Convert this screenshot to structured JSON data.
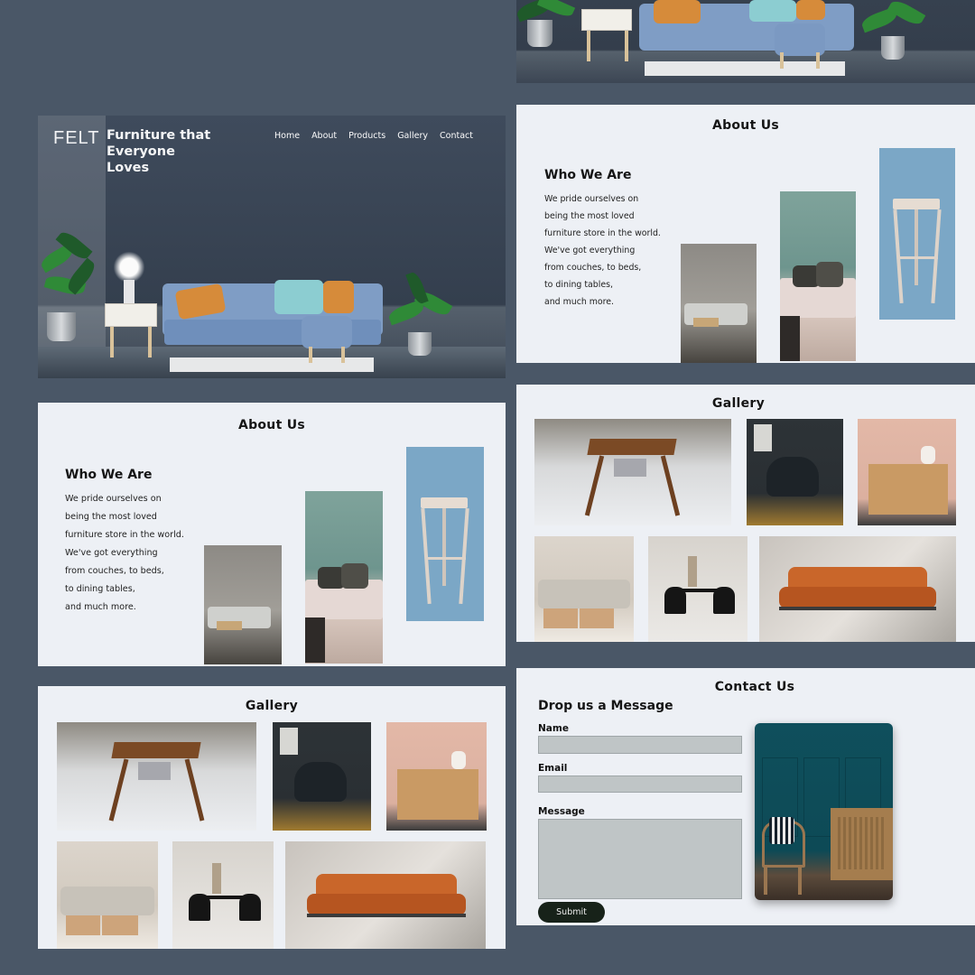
{
  "brand": {
    "logo": "FELT",
    "tagline": "Furniture that Everyone Loves"
  },
  "nav": {
    "items": [
      "Home",
      "About",
      "Products",
      "Gallery",
      "Contact"
    ]
  },
  "about": {
    "title": "About Us",
    "heading": "Who We Are",
    "lines": [
      "We pride ourselves on",
      "being the most loved",
      "furniture store in the world.",
      "We've got everything",
      "from couches, to beds,",
      "to dining tables,",
      "and much more."
    ]
  },
  "gallery": {
    "title": "Gallery"
  },
  "contact": {
    "title": "Contact Us",
    "heading": "Drop us a Message",
    "name_label": "Name",
    "email_label": "Email",
    "message_label": "Message",
    "submit_label": "Submit"
  },
  "colors": {
    "background": "#4a5767",
    "panel": "#edf0f5",
    "field": "#bfc5c6",
    "button": "#172219",
    "accent_blue": "#7f9dc5"
  }
}
